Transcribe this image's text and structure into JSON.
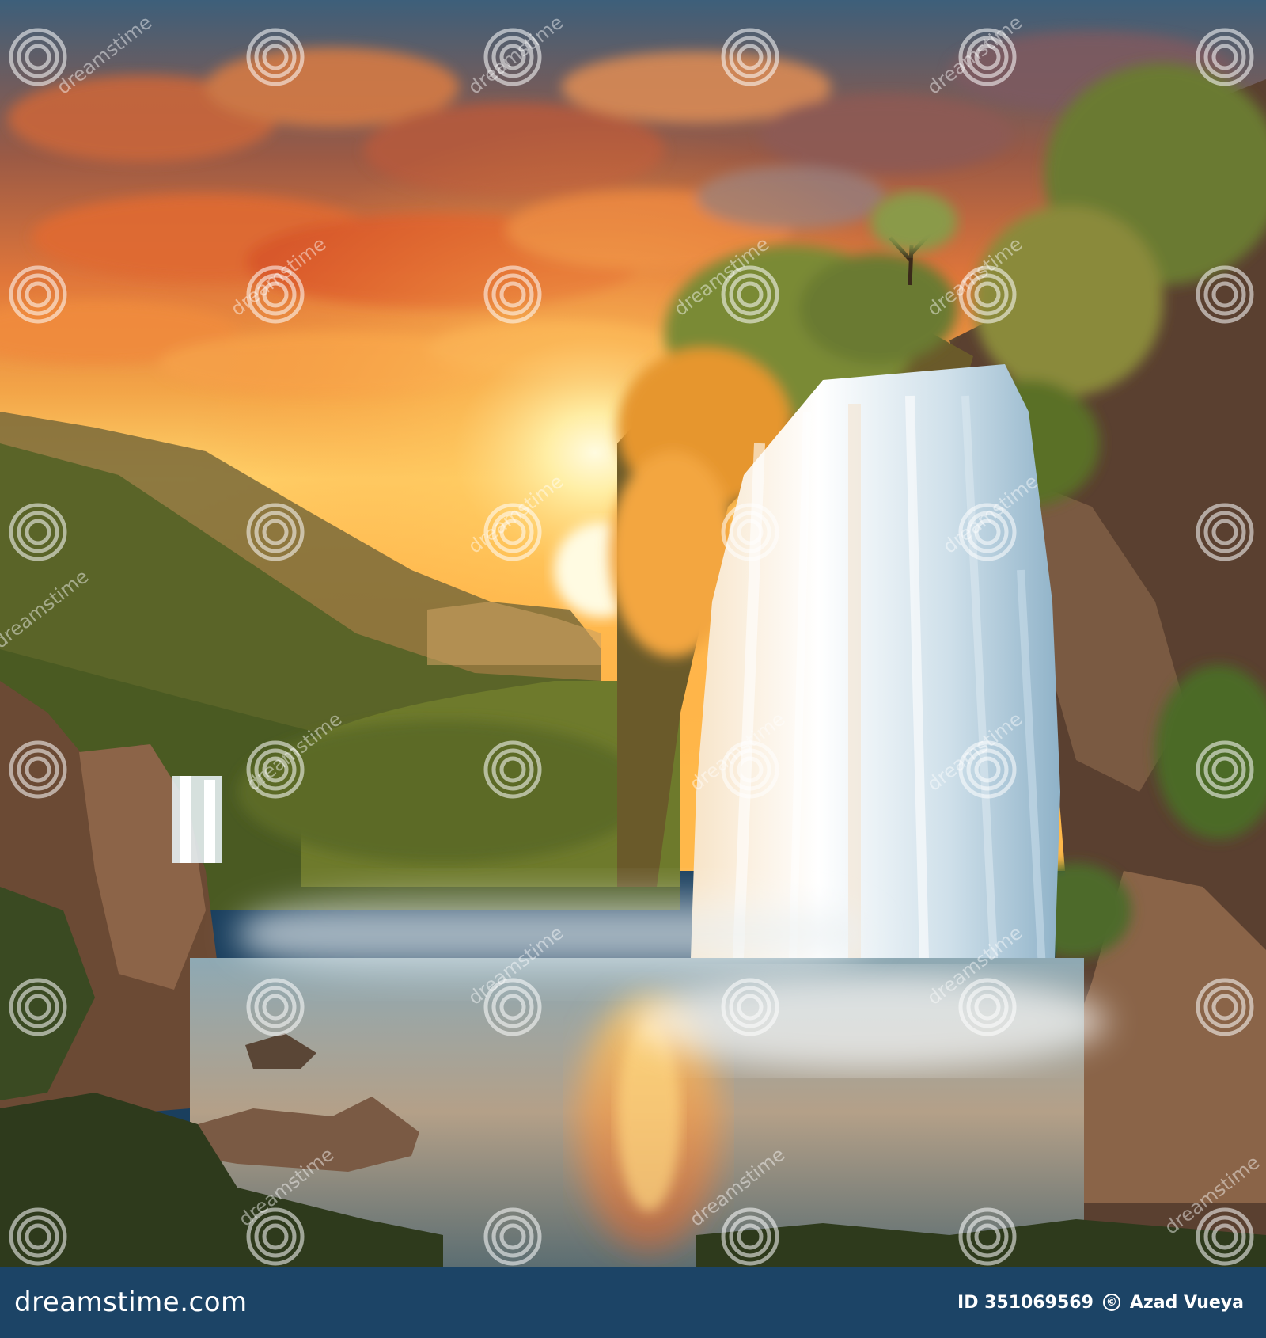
{
  "footer": {
    "brand": "dreamstime.com",
    "id_label": "ID 351069569",
    "copyright_icon": "copyright-icon",
    "author": "Azad Vueya"
  },
  "watermark": {
    "text": "dreamstime",
    "icon": "spiral-logo-icon"
  },
  "colors": {
    "sky_top": "#3d5f7a",
    "sky_glow": "#ffd36a",
    "sun": "#fff6c8",
    "clouds": "#e0763a",
    "foliage": "#3f5a1f",
    "rock": "#6b4a34",
    "water": "#a9c6d8",
    "footer_bg": "#1c4466"
  }
}
